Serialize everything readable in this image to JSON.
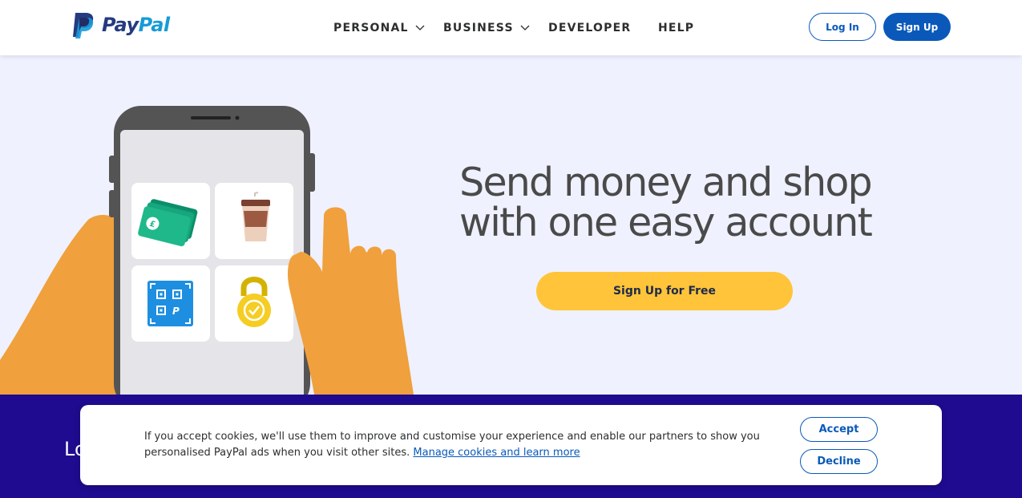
{
  "brand": {
    "name_part1": "Pay",
    "name_part2": "Pal",
    "colors": {
      "navy": "#253b80",
      "sky": "#179bd7",
      "primary_blue": "#0a59ba",
      "cta_yellow": "#ffc439",
      "band_purple": "#1e0b8f",
      "hero_bg": "#eff1fe"
    }
  },
  "nav": {
    "items": [
      {
        "label": "PERSONAL",
        "has_dropdown": true
      },
      {
        "label": "BUSINESS",
        "has_dropdown": true
      },
      {
        "label": "DEVELOPER",
        "has_dropdown": false
      },
      {
        "label": "HELP",
        "has_dropdown": false
      }
    ],
    "login_label": "Log In",
    "signup_label": "Sign Up"
  },
  "hero": {
    "title_line1": "Send money and shop",
    "title_line2": "with one easy account",
    "cta_label": "Sign Up for Free",
    "phone_tiles": [
      {
        "icon": "banknotes-icon"
      },
      {
        "icon": "coffee-cup-icon"
      },
      {
        "icon": "qr-code-icon"
      },
      {
        "icon": "padlock-icon"
      }
    ]
  },
  "band": {
    "peek_text": "Lo"
  },
  "cookie_banner": {
    "text": "If you accept cookies, we'll use them to improve and customise your experience and enable our partners to show you personalised PayPal ads when you visit other sites.",
    "link_label": "Manage cookies and learn more",
    "accept_label": "Accept",
    "decline_label": "Decline"
  }
}
